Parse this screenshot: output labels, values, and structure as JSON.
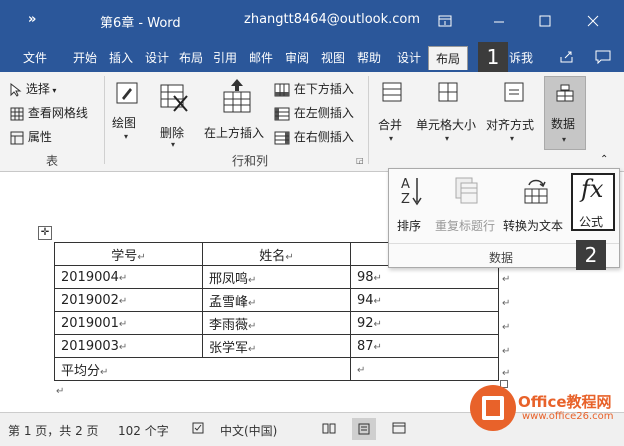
{
  "titlebar": {
    "doc_title": "第6章 - Word",
    "user": "zhangtt8464@outlook.com",
    "menu_glyph": "»"
  },
  "tabs": [
    {
      "label": "文件"
    },
    {
      "label": "开始"
    },
    {
      "label": "插入"
    },
    {
      "label": "设计"
    },
    {
      "label": "布局"
    },
    {
      "label": "引用"
    },
    {
      "label": "邮件"
    },
    {
      "label": "审阅"
    },
    {
      "label": "视图"
    },
    {
      "label": "帮助"
    },
    {
      "label": "设计"
    },
    {
      "label": "布局"
    },
    {
      "label": "诉我"
    }
  ],
  "ribbon": {
    "select": "选择",
    "view_gridlines": "查看网格线",
    "properties": "属性",
    "group_table": "表",
    "draw": "绘图",
    "delete": "删除",
    "insert_above": "在上方插入",
    "insert_below": "在下方插入",
    "insert_left": "在左侧插入",
    "insert_right": "在右侧插入",
    "group_rows_cols": "行和列",
    "merge": "合并",
    "cell_size": "单元格大小",
    "alignment": "对齐方式",
    "data": "数据"
  },
  "data_panel": {
    "sort": "排序",
    "repeat_header": "重复标题行",
    "convert_text": "转换为文本",
    "formula": "公式",
    "group_label": "数据"
  },
  "callouts": {
    "one": "1",
    "two": "2"
  },
  "table": {
    "headers": [
      "学号",
      "姓名",
      ""
    ],
    "rows": [
      [
        "2019004",
        "邢凤鸣",
        "98"
      ],
      [
        "2019002",
        "孟雪峰",
        "94"
      ],
      [
        "2019001",
        "李雨薇",
        "92"
      ],
      [
        "2019003",
        "张学军",
        "87"
      ]
    ],
    "footer_label": "平均分"
  },
  "statusbar": {
    "page": "第 1 页，共 2 页",
    "words": "102 个字",
    "language": "中文(中国)"
  },
  "watermark": {
    "brand": "Office教程网",
    "url": "www.office26.com"
  },
  "colors": {
    "accent": "#2b579a",
    "badge": "#3c3c3c"
  }
}
